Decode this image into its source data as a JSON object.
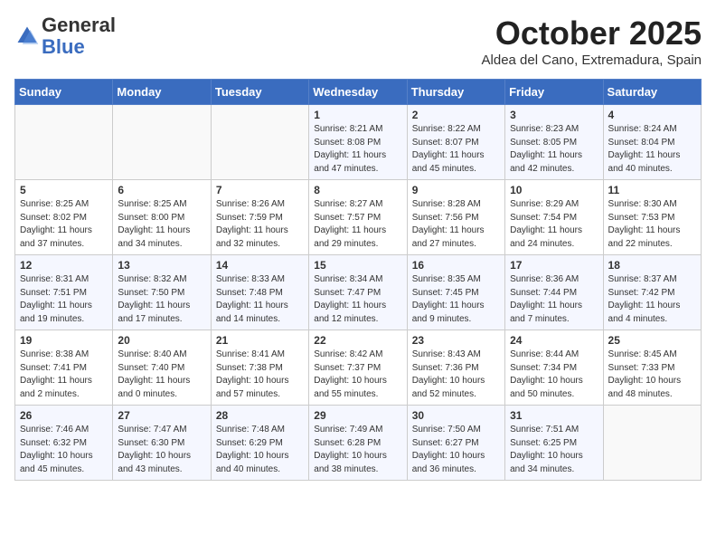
{
  "header": {
    "logo_general": "General",
    "logo_blue": "Blue",
    "month_title": "October 2025",
    "location": "Aldea del Cano, Extremadura, Spain"
  },
  "weekdays": [
    "Sunday",
    "Monday",
    "Tuesday",
    "Wednesday",
    "Thursday",
    "Friday",
    "Saturday"
  ],
  "weeks": [
    [
      {
        "day": "",
        "info": ""
      },
      {
        "day": "",
        "info": ""
      },
      {
        "day": "",
        "info": ""
      },
      {
        "day": "1",
        "info": "Sunrise: 8:21 AM\nSunset: 8:08 PM\nDaylight: 11 hours and 47 minutes."
      },
      {
        "day": "2",
        "info": "Sunrise: 8:22 AM\nSunset: 8:07 PM\nDaylight: 11 hours and 45 minutes."
      },
      {
        "day": "3",
        "info": "Sunrise: 8:23 AM\nSunset: 8:05 PM\nDaylight: 11 hours and 42 minutes."
      },
      {
        "day": "4",
        "info": "Sunrise: 8:24 AM\nSunset: 8:04 PM\nDaylight: 11 hours and 40 minutes."
      }
    ],
    [
      {
        "day": "5",
        "info": "Sunrise: 8:25 AM\nSunset: 8:02 PM\nDaylight: 11 hours and 37 minutes."
      },
      {
        "day": "6",
        "info": "Sunrise: 8:25 AM\nSunset: 8:00 PM\nDaylight: 11 hours and 34 minutes."
      },
      {
        "day": "7",
        "info": "Sunrise: 8:26 AM\nSunset: 7:59 PM\nDaylight: 11 hours and 32 minutes."
      },
      {
        "day": "8",
        "info": "Sunrise: 8:27 AM\nSunset: 7:57 PM\nDaylight: 11 hours and 29 minutes."
      },
      {
        "day": "9",
        "info": "Sunrise: 8:28 AM\nSunset: 7:56 PM\nDaylight: 11 hours and 27 minutes."
      },
      {
        "day": "10",
        "info": "Sunrise: 8:29 AM\nSunset: 7:54 PM\nDaylight: 11 hours and 24 minutes."
      },
      {
        "day": "11",
        "info": "Sunrise: 8:30 AM\nSunset: 7:53 PM\nDaylight: 11 hours and 22 minutes."
      }
    ],
    [
      {
        "day": "12",
        "info": "Sunrise: 8:31 AM\nSunset: 7:51 PM\nDaylight: 11 hours and 19 minutes."
      },
      {
        "day": "13",
        "info": "Sunrise: 8:32 AM\nSunset: 7:50 PM\nDaylight: 11 hours and 17 minutes."
      },
      {
        "day": "14",
        "info": "Sunrise: 8:33 AM\nSunset: 7:48 PM\nDaylight: 11 hours and 14 minutes."
      },
      {
        "day": "15",
        "info": "Sunrise: 8:34 AM\nSunset: 7:47 PM\nDaylight: 11 hours and 12 minutes."
      },
      {
        "day": "16",
        "info": "Sunrise: 8:35 AM\nSunset: 7:45 PM\nDaylight: 11 hours and 9 minutes."
      },
      {
        "day": "17",
        "info": "Sunrise: 8:36 AM\nSunset: 7:44 PM\nDaylight: 11 hours and 7 minutes."
      },
      {
        "day": "18",
        "info": "Sunrise: 8:37 AM\nSunset: 7:42 PM\nDaylight: 11 hours and 4 minutes."
      }
    ],
    [
      {
        "day": "19",
        "info": "Sunrise: 8:38 AM\nSunset: 7:41 PM\nDaylight: 11 hours and 2 minutes."
      },
      {
        "day": "20",
        "info": "Sunrise: 8:40 AM\nSunset: 7:40 PM\nDaylight: 11 hours and 0 minutes."
      },
      {
        "day": "21",
        "info": "Sunrise: 8:41 AM\nSunset: 7:38 PM\nDaylight: 10 hours and 57 minutes."
      },
      {
        "day": "22",
        "info": "Sunrise: 8:42 AM\nSunset: 7:37 PM\nDaylight: 10 hours and 55 minutes."
      },
      {
        "day": "23",
        "info": "Sunrise: 8:43 AM\nSunset: 7:36 PM\nDaylight: 10 hours and 52 minutes."
      },
      {
        "day": "24",
        "info": "Sunrise: 8:44 AM\nSunset: 7:34 PM\nDaylight: 10 hours and 50 minutes."
      },
      {
        "day": "25",
        "info": "Sunrise: 8:45 AM\nSunset: 7:33 PM\nDaylight: 10 hours and 48 minutes."
      }
    ],
    [
      {
        "day": "26",
        "info": "Sunrise: 7:46 AM\nSunset: 6:32 PM\nDaylight: 10 hours and 45 minutes."
      },
      {
        "day": "27",
        "info": "Sunrise: 7:47 AM\nSunset: 6:30 PM\nDaylight: 10 hours and 43 minutes."
      },
      {
        "day": "28",
        "info": "Sunrise: 7:48 AM\nSunset: 6:29 PM\nDaylight: 10 hours and 40 minutes."
      },
      {
        "day": "29",
        "info": "Sunrise: 7:49 AM\nSunset: 6:28 PM\nDaylight: 10 hours and 38 minutes."
      },
      {
        "day": "30",
        "info": "Sunrise: 7:50 AM\nSunset: 6:27 PM\nDaylight: 10 hours and 36 minutes."
      },
      {
        "day": "31",
        "info": "Sunrise: 7:51 AM\nSunset: 6:25 PM\nDaylight: 10 hours and 34 minutes."
      },
      {
        "day": "",
        "info": ""
      }
    ]
  ]
}
